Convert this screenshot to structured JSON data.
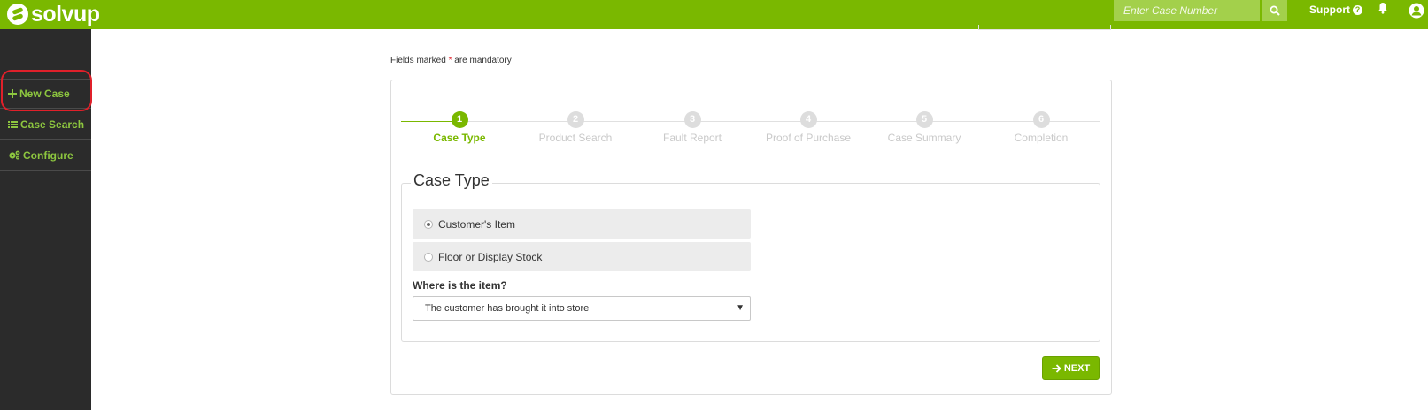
{
  "app": {
    "brand": "solvup"
  },
  "header": {
    "case_input_placeholder": "Enter Case Number",
    "support_label": "Support",
    "icons": [
      "search-icon",
      "help-icon",
      "bell-icon",
      "user-icon"
    ],
    "accent_color": "#7ab800"
  },
  "sidebar": {
    "items": [
      {
        "label": "New Case",
        "icon": "plus-icon"
      },
      {
        "label": "Case Search",
        "icon": "list-icon"
      },
      {
        "label": "Configure",
        "icon": "gears-icon"
      }
    ],
    "highlight_color": "#e0202a"
  },
  "form": {
    "mandatory_prefix": "Fields marked",
    "mandatory_star": "*",
    "mandatory_suffix": "are mandatory",
    "steps": [
      {
        "number": "1",
        "label": "Case Type",
        "active": true
      },
      {
        "number": "2",
        "label": "Product Search",
        "active": false
      },
      {
        "number": "3",
        "label": "Fault Report",
        "active": false
      },
      {
        "number": "4",
        "label": "Proof of Purchase",
        "active": false
      },
      {
        "number": "5",
        "label": "Case Summary",
        "active": false
      },
      {
        "number": "6",
        "label": "Completion",
        "active": false
      }
    ],
    "section_title": "Case Type",
    "options": [
      {
        "label": "Customer's Item",
        "checked": true
      },
      {
        "label": "Floor or Display Stock",
        "checked": false
      }
    ],
    "where_label": "Where is the item?",
    "where_selected": "The customer has brought it into store",
    "next_label": "NEXT"
  }
}
